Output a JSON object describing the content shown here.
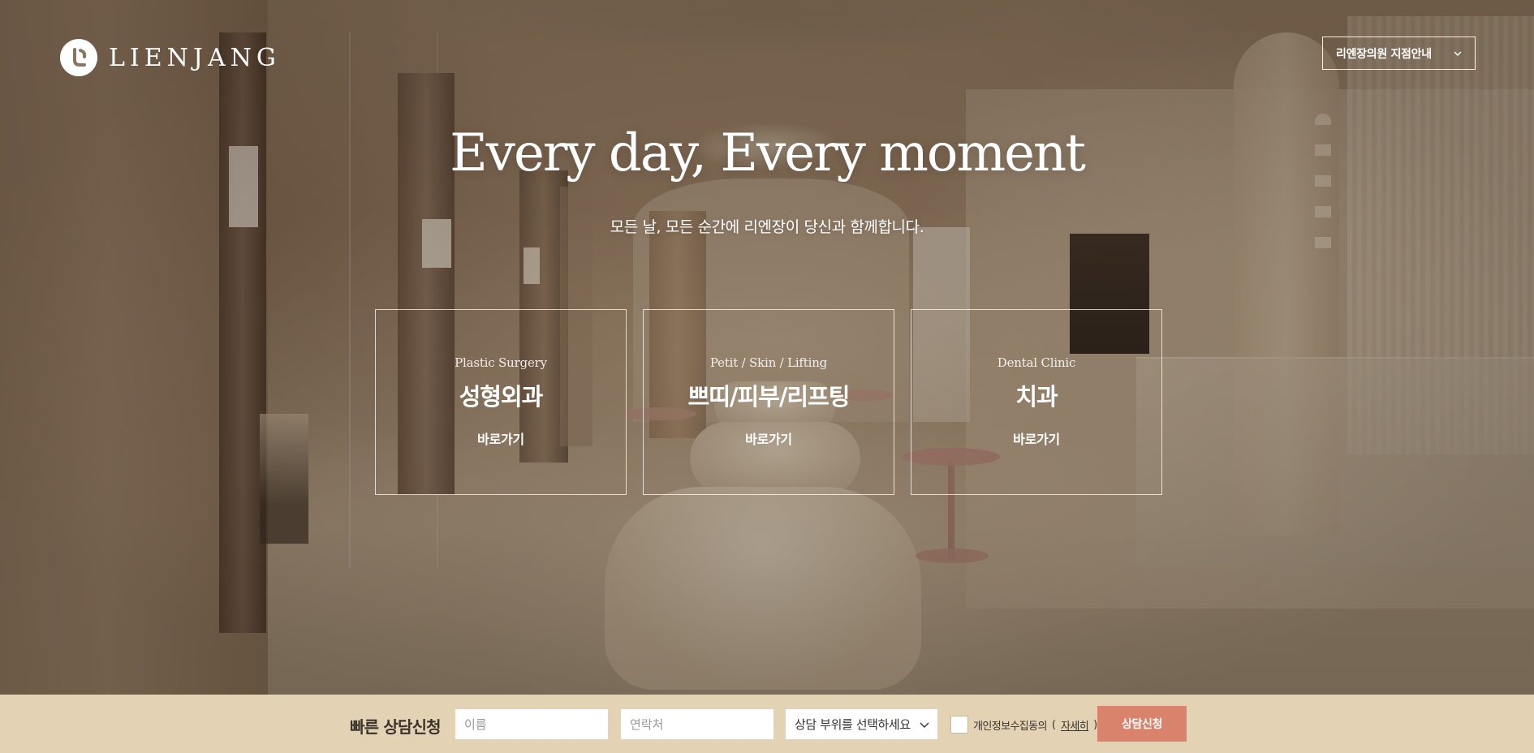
{
  "header": {
    "logo_text": "LIENJANG",
    "branch_select_label": "리엔장의원 지점안내"
  },
  "hero": {
    "headline": "Every day, Every moment",
    "subline": "모든 날, 모든 순간에 리엔장이 당신과 함께합니다."
  },
  "cards": [
    {
      "en": "Plastic Surgery",
      "ko": "성형외과",
      "link": "바로가기"
    },
    {
      "en": "Petit / Skin / Lifting",
      "ko": "쁘띠/피부/리프팅",
      "link": "바로가기"
    },
    {
      "en": "Dental Clinic",
      "ko": "치과",
      "link": "바로가기"
    }
  ],
  "consult": {
    "title": "빠른 상담신청",
    "name_placeholder": "이름",
    "phone_placeholder": "연락처",
    "part_select_label": "상담 부위를 선택하세요",
    "agree_text": "개인정보수집동의",
    "agree_link": "자세히",
    "submit_label": "상담신청"
  },
  "colors": {
    "consult_bar_bg": "#e3d3b4",
    "submit_bg": "#d9836c",
    "text_dark": "#3a322b"
  },
  "icons": {
    "logo": "lienjang-logo-icon",
    "branch_chevron": "chevron-down-icon",
    "part_chevron": "chevron-down-icon",
    "agree_checkbox": "checkbox-icon"
  }
}
